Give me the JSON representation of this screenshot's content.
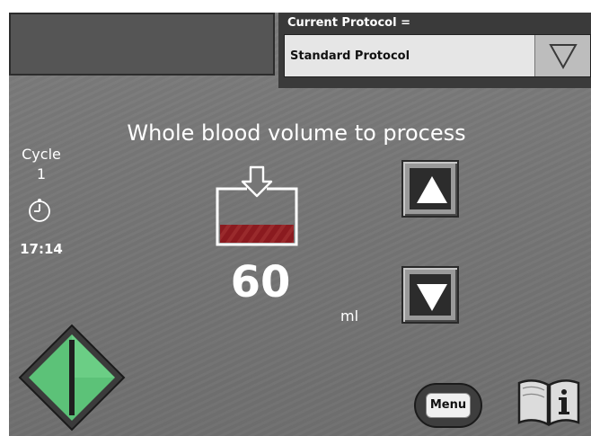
{
  "header": {
    "protocol_label": "Current Protocol =",
    "protocol_value": "Standard Protocol"
  },
  "cycle": {
    "label": "Cycle",
    "value": "1",
    "time": "17:14"
  },
  "main": {
    "title": "Whole blood volume to process",
    "volume": "60",
    "unit": "ml"
  },
  "buttons": {
    "menu_label": "Menu"
  },
  "icons": {
    "protocol_dropdown": "triangle-down-icon",
    "timer": "clock-icon",
    "container": "blood-container-icon",
    "increase": "arrow-up-icon",
    "decrease": "arrow-down-icon",
    "start": "start-diamond-icon",
    "info": "book-info-icon"
  },
  "colors": {
    "screen_bg": "#767676",
    "blood": "#8b1a1f",
    "start_green": "#5cc278"
  }
}
